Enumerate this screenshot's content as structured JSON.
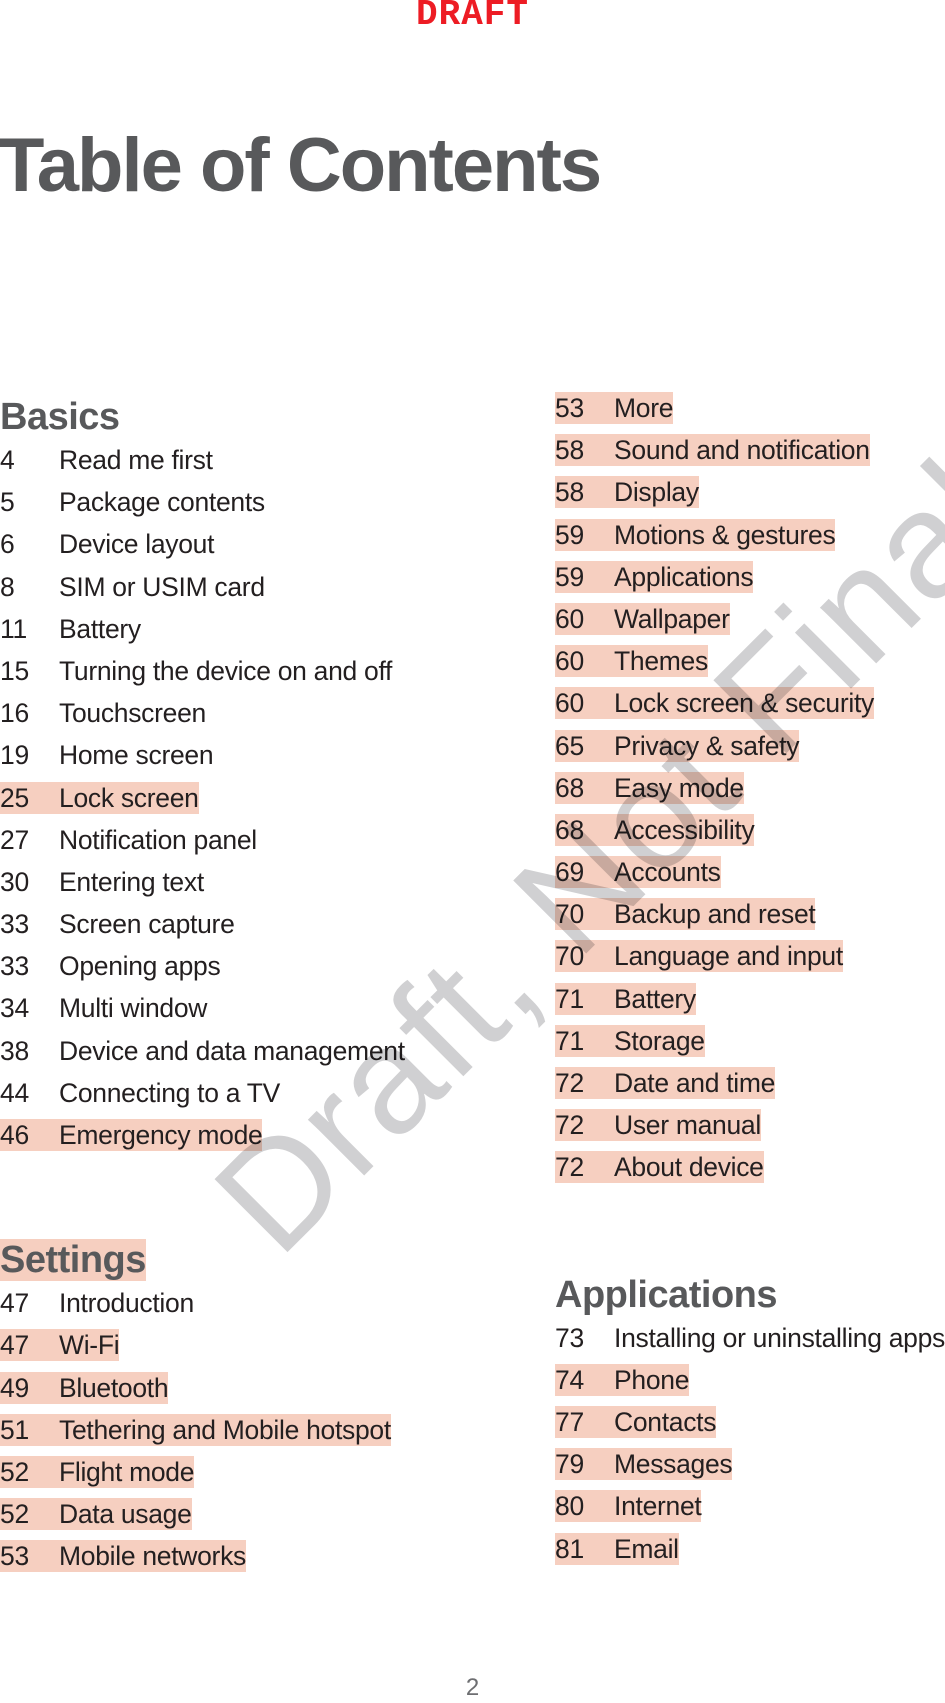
{
  "draft_stamp": "DRAFT",
  "title": "Table of Contents",
  "watermark": "Draft, Not Final",
  "page_number": "2",
  "highlight_color": "#f6cfc0",
  "sections": {
    "basics": {
      "heading": "Basics",
      "heading_highlighted": false,
      "entries": [
        {
          "page": "4",
          "label": "Read me first",
          "highlighted": false
        },
        {
          "page": "5",
          "label": "Package contents",
          "highlighted": false
        },
        {
          "page": "6",
          "label": "Device layout",
          "highlighted": false
        },
        {
          "page": "8",
          "label": "SIM or USIM card",
          "highlighted": false
        },
        {
          "page": "11",
          "label": "Battery",
          "highlighted": false
        },
        {
          "page": "15",
          "label": "Turning the device on and off",
          "highlighted": false
        },
        {
          "page": "16",
          "label": "Touchscreen",
          "highlighted": false
        },
        {
          "page": "19",
          "label": "Home screen",
          "highlighted": false
        },
        {
          "page": "25",
          "label": "Lock screen",
          "highlighted": true
        },
        {
          "page": "27",
          "label": "Notification panel",
          "highlighted": false
        },
        {
          "page": "30",
          "label": "Entering text",
          "highlighted": false
        },
        {
          "page": "33",
          "label": "Screen capture",
          "highlighted": false
        },
        {
          "page": "33",
          "label": "Opening apps",
          "highlighted": false
        },
        {
          "page": "34",
          "label": "Multi window",
          "highlighted": false
        },
        {
          "page": "38",
          "label": "Device and data management",
          "highlighted": false
        },
        {
          "page": "44",
          "label": "Connecting to a TV",
          "highlighted": false
        },
        {
          "page": "46",
          "label": "Emergency mode",
          "highlighted": true
        }
      ]
    },
    "settings": {
      "heading": "Settings",
      "heading_highlighted": true,
      "entries": [
        {
          "page": "47",
          "label": "Introduction",
          "highlighted": false
        },
        {
          "page": "47",
          "label": "Wi-Fi",
          "highlighted": true
        },
        {
          "page": "49",
          "label": "Bluetooth",
          "highlighted": true
        },
        {
          "page": "51",
          "label": "Tethering and Mobile hotspot",
          "highlighted": true
        },
        {
          "page": "52",
          "label": "Flight mode",
          "highlighted": true
        },
        {
          "page": "52",
          "label": "Data usage",
          "highlighted": true
        },
        {
          "page": "53",
          "label": "Mobile networks",
          "highlighted": true
        },
        {
          "page": "53",
          "label": "More",
          "highlighted": true
        },
        {
          "page": "58",
          "label": "Sound and notification",
          "highlighted": true
        },
        {
          "page": "58",
          "label": "Display",
          "highlighted": true
        },
        {
          "page": "59",
          "label": "Motions & gestures",
          "highlighted": true
        },
        {
          "page": "59",
          "label": "Applications",
          "highlighted": true
        },
        {
          "page": "60",
          "label": "Wallpaper",
          "highlighted": true
        },
        {
          "page": "60",
          "label": "Themes",
          "highlighted": true
        },
        {
          "page": "60",
          "label": "Lock screen & security",
          "highlighted": true
        },
        {
          "page": "65",
          "label": "Privacy & safety",
          "highlighted": true
        },
        {
          "page": "68",
          "label": "Easy mode",
          "highlighted": true
        },
        {
          "page": "68",
          "label": "Accessibility",
          "highlighted": true
        },
        {
          "page": "69",
          "label": "Accounts",
          "highlighted": true
        },
        {
          "page": "70",
          "label": "Backup and reset",
          "highlighted": true
        },
        {
          "page": "70",
          "label": "Language and input",
          "highlighted": true
        },
        {
          "page": "71",
          "label": "Battery",
          "highlighted": true
        },
        {
          "page": "71",
          "label": "Storage",
          "highlighted": true
        },
        {
          "page": "72",
          "label": "Date and time",
          "highlighted": true
        },
        {
          "page": "72",
          "label": "User manual",
          "highlighted": true
        },
        {
          "page": "72",
          "label": "About device",
          "highlighted": true
        }
      ]
    },
    "applications": {
      "heading": "Applications",
      "heading_highlighted": false,
      "entries": [
        {
          "page": "73",
          "label": "Installing or uninstalling apps",
          "highlighted": false
        },
        {
          "page": "74",
          "label": "Phone",
          "highlighted": true
        },
        {
          "page": "77",
          "label": "Contacts",
          "highlighted": true
        },
        {
          "page": "79",
          "label": "Messages",
          "highlighted": true
        },
        {
          "page": "80",
          "label": "Internet",
          "highlighted": true
        },
        {
          "page": "81",
          "label": "Email",
          "highlighted": true
        }
      ]
    }
  }
}
